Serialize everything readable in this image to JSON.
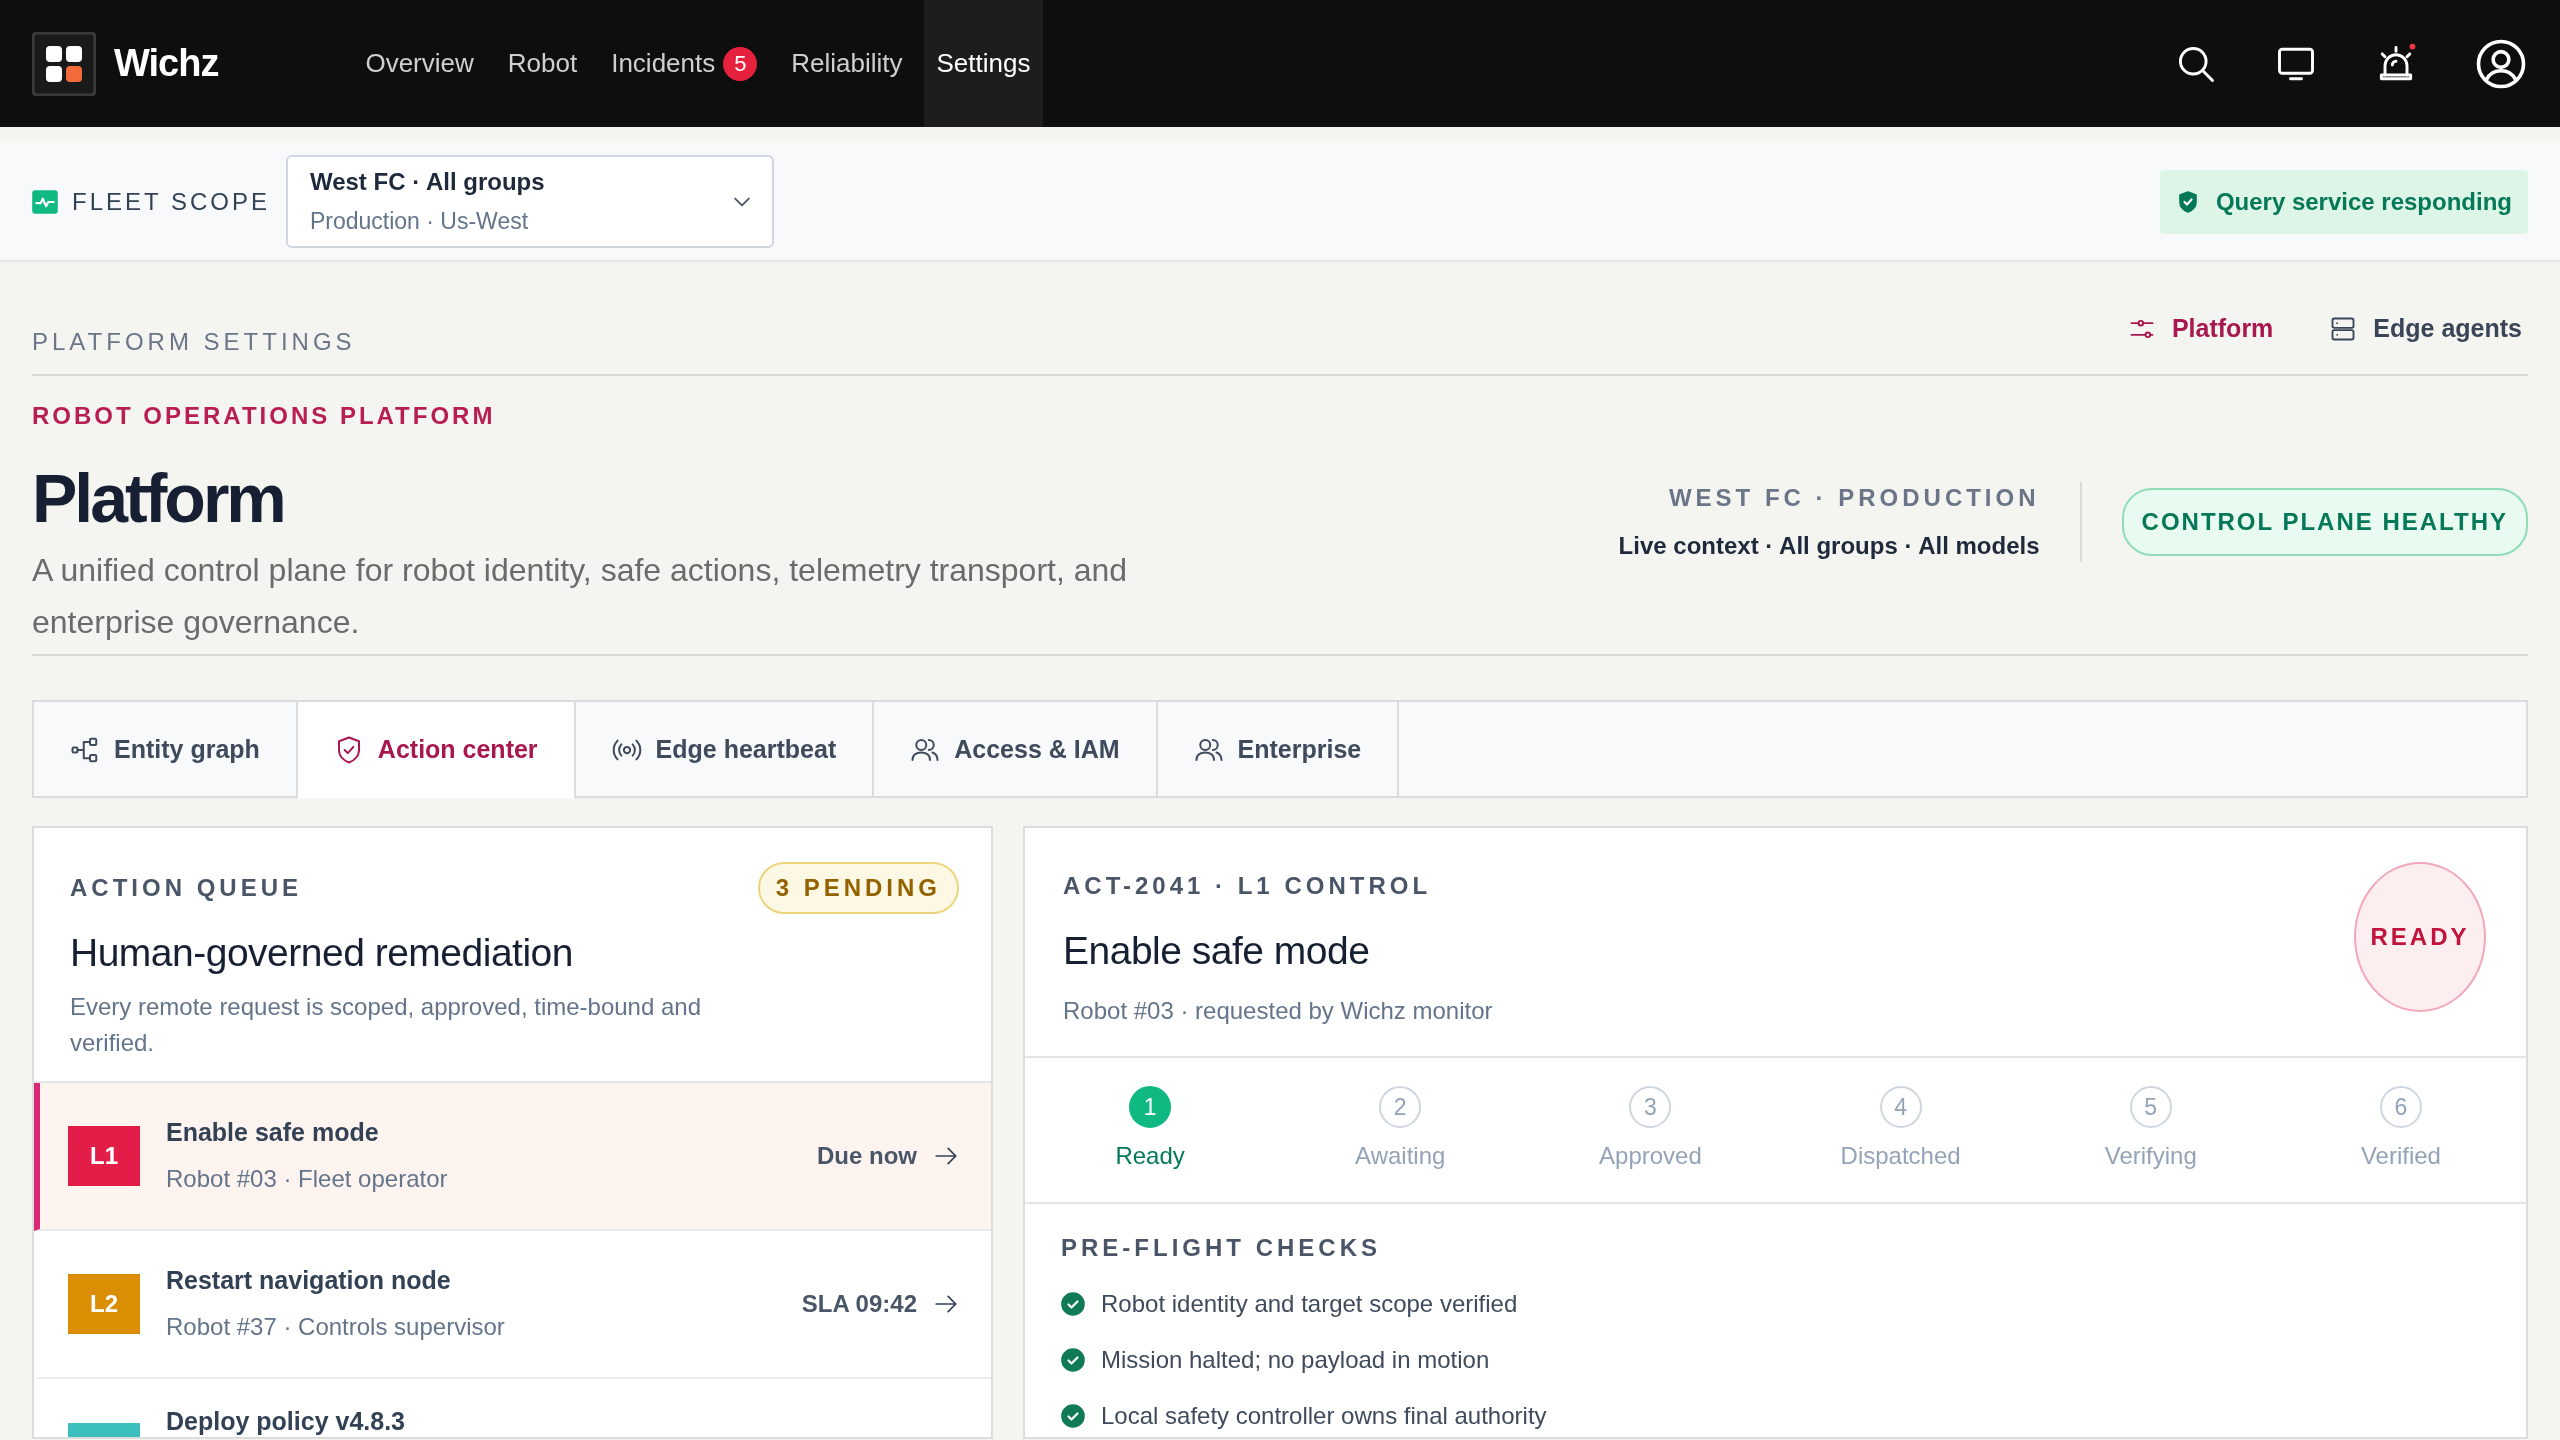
{
  "brand": {
    "name": "Wichz"
  },
  "nav": [
    {
      "label": "Overview",
      "selected": false
    },
    {
      "label": "Robot",
      "selected": false
    },
    {
      "label": "Incidents",
      "selected": false,
      "badge": "5"
    },
    {
      "label": "Reliability",
      "selected": false
    },
    {
      "label": "Settings",
      "selected": true
    }
  ],
  "bell": {
    "unread": true
  },
  "scope": {
    "label": "FLEET SCOPE",
    "value": "West FC · All groups",
    "detail": "Production · Us-West"
  },
  "service_status": {
    "text": "Query service responding"
  },
  "settings_header": {
    "title": "PLATFORM SETTINGS",
    "tabs": [
      {
        "label": "Platform",
        "selected": true
      },
      {
        "label": "Edge agents",
        "selected": false
      }
    ]
  },
  "page": {
    "eyebrow": "ROBOT OPERATIONS PLATFORM",
    "title": "Platform",
    "description": "A unified control plane for robot identity, safe actions, telemetry transport, and enterprise governance.",
    "context_label": "WEST FC · PRODUCTION",
    "context_detail": "Live context · All groups · All models",
    "health": "CONTROL PLANE HEALTHY"
  },
  "tabs": [
    {
      "label": "Entity graph",
      "selected": false
    },
    {
      "label": "Action center",
      "selected": true
    },
    {
      "label": "Edge heartbeat",
      "selected": false
    },
    {
      "label": "Access & IAM",
      "selected": false
    },
    {
      "label": "Enterprise",
      "selected": false
    }
  ],
  "queue": {
    "label": "ACTION QUEUE",
    "badge": "3 PENDING",
    "title": "Human-governed remediation",
    "description": "Every remote request is scoped, approved, time-bound and verified.",
    "items": [
      {
        "level_label": "L1",
        "color": "#e11d48",
        "title": "Enable safe mode",
        "detail": "Robot #03 · Fleet operator",
        "due": "Due now",
        "selected": true
      },
      {
        "level_label": "L2",
        "color": "#d98e04",
        "title": "Restart navigation node",
        "detail": "Robot #37 · Controls supervisor",
        "due": "SLA 09:42",
        "selected": false
      },
      {
        "color": "#3dbfc0",
        "title": "Deploy policy v4.8.3",
        "selected": false
      }
    ]
  },
  "action": {
    "eyebrow": "ACT-2041 · L1 CONTROL",
    "title": "Enable safe mode",
    "detail": "Robot #03 · requested by Wichz monitor",
    "status": "READY",
    "steps": [
      {
        "number": "1",
        "label": "Ready",
        "selected": true
      },
      {
        "number": "2",
        "label": "Awaiting",
        "selected": false
      },
      {
        "number": "3",
        "label": "Approved",
        "selected": false
      },
      {
        "number": "4",
        "label": "Dispatched",
        "selected": false
      },
      {
        "number": "5",
        "label": "Verifying",
        "selected": false
      },
      {
        "number": "6",
        "label": "Verified",
        "selected": false
      }
    ],
    "checks_title": "PRE-FLIGHT CHECKS",
    "checks": [
      {
        "text": "Robot identity and target scope verified",
        "checked": true
      },
      {
        "text": "Mission halted; no payload in motion",
        "checked": true
      },
      {
        "text": "Local safety controller owns final authority",
        "checked": true
      }
    ]
  }
}
